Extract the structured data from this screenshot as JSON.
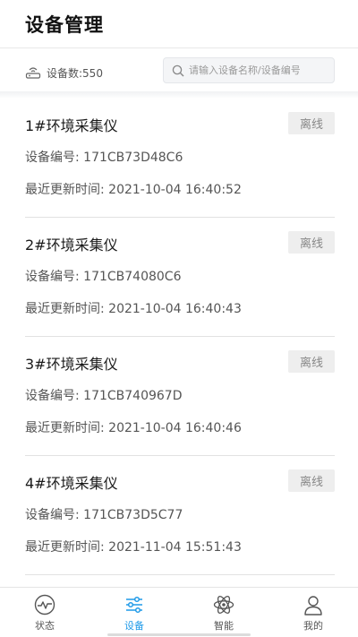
{
  "header": {
    "title": "设备管理"
  },
  "toolbar": {
    "device_count_label": "设备数:550",
    "search_placeholder": "请输入设备名称/设备编号"
  },
  "devices": [
    {
      "name": "1#环境采集仪",
      "status": "离线",
      "id_line": "设备编号: 171CB73D48C6",
      "time_line": "最近更新时间: 2021-10-04 16:40:52"
    },
    {
      "name": "2#环境采集仪",
      "status": "离线",
      "id_line": "设备编号: 171CB74080C6",
      "time_line": "最近更新时间: 2021-10-04 16:40:43"
    },
    {
      "name": "3#环境采集仪",
      "status": "离线",
      "id_line": "设备编号: 171CB740967D",
      "time_line": "最近更新时间: 2021-10-04 16:40:46"
    },
    {
      "name": "4#环境采集仪",
      "status": "离线",
      "id_line": "设备编号: 171CB73D5C77",
      "time_line": "最近更新时间: 2021-11-04 15:51:43"
    }
  ],
  "tabs": [
    {
      "label": "状态",
      "icon": "status-gauge-icon",
      "active": false
    },
    {
      "label": "设备",
      "icon": "sliders-icon",
      "active": true
    },
    {
      "label": "智能",
      "icon": "atom-icon",
      "active": false
    },
    {
      "label": "我的",
      "icon": "user-icon",
      "active": false
    }
  ],
  "colors": {
    "accent": "#1f9ae8",
    "badge_bg": "#eeeeee",
    "badge_text": "#888888"
  }
}
